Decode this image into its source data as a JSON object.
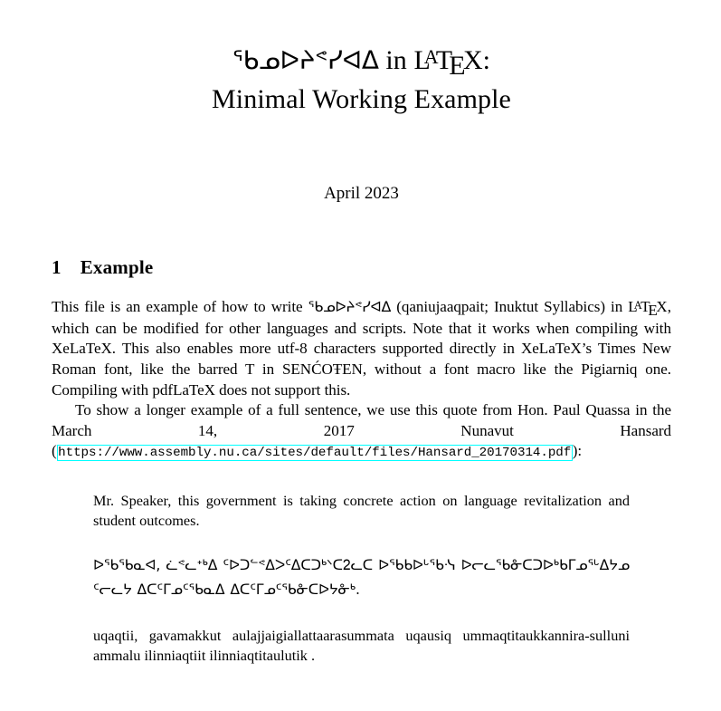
{
  "document": {
    "title": {
      "line1_syllabics": "ᖃᓄᐅᔨᕝᓯᐊᐃ",
      "line1_in": "in",
      "line1_colon": ":",
      "line2": "Minimal Working Example"
    },
    "date": "April 2023",
    "section": {
      "number": "1",
      "heading": "Example"
    },
    "body": {
      "p1_a": "This file is an example of how to write ",
      "p1_syllabics": "ᖃᓄᐅᔨᕝᓯᐊᐃ",
      "p1_b": " (qaniujaaqpait; Inuktut Syllabics) in ",
      "p1_c": ", which can be modified for other languages and scripts. Note that it works when compiling with XeLaTeX. This also enables more utf-8 characters supported directly in XeLaTeX’s Times New Roman font, like the barred T in SENĆOŦEN, without a font macro like the Pigiarniq one. Compiling with pdfLaTeX does not support this.",
      "p2_a": "To show a longer example of a full sentence, we use this quote from Hon. Paul Quassa in the March 14, 2017 Nunavut Hansard (",
      "p2_url": "https://www.assembly.nu.ca/sites/default/files/Hansard_20170314.pdf",
      "p2_b": "):"
    },
    "quotes": {
      "english": "Mr. Speaker, this government is taking concrete action on language revitalization and student outcomes.",
      "syllabics": "ᐅᖃᖃᓇᐊ, ᓛᕝᓚᕀᒃᐃ ᑦᐅᑐᓪᕝᐃᐳᑦᐃᑕᑐᒃᐠᑕᒿᓚᑕ ᐅᖃᑲᐅᒡᖃᓶ ᐅᓕᓚᖃᓁᑕᑐᐅᒃᑲᒥᓄᕐᒡᐃᔭᓄ ᑦᓕᓚᔭ ᐃᑕᑦᒥᓄᑦᖃᓇᐃ ᐃᑕᑦᒥᓄᑦᖃᓁᑕᐅᔭᓁᒃ.",
      "roman": "uqaqtii, gavamakkut aulajjaigiallattaarasummata uqausiq ummaqtitaukkannira-sulluni ammalu ilinniaqtiit ilinniaqtitaulutik ."
    },
    "colors": {
      "link_border": "#00ffff",
      "text": "#000000",
      "background": "#ffffff"
    }
  }
}
